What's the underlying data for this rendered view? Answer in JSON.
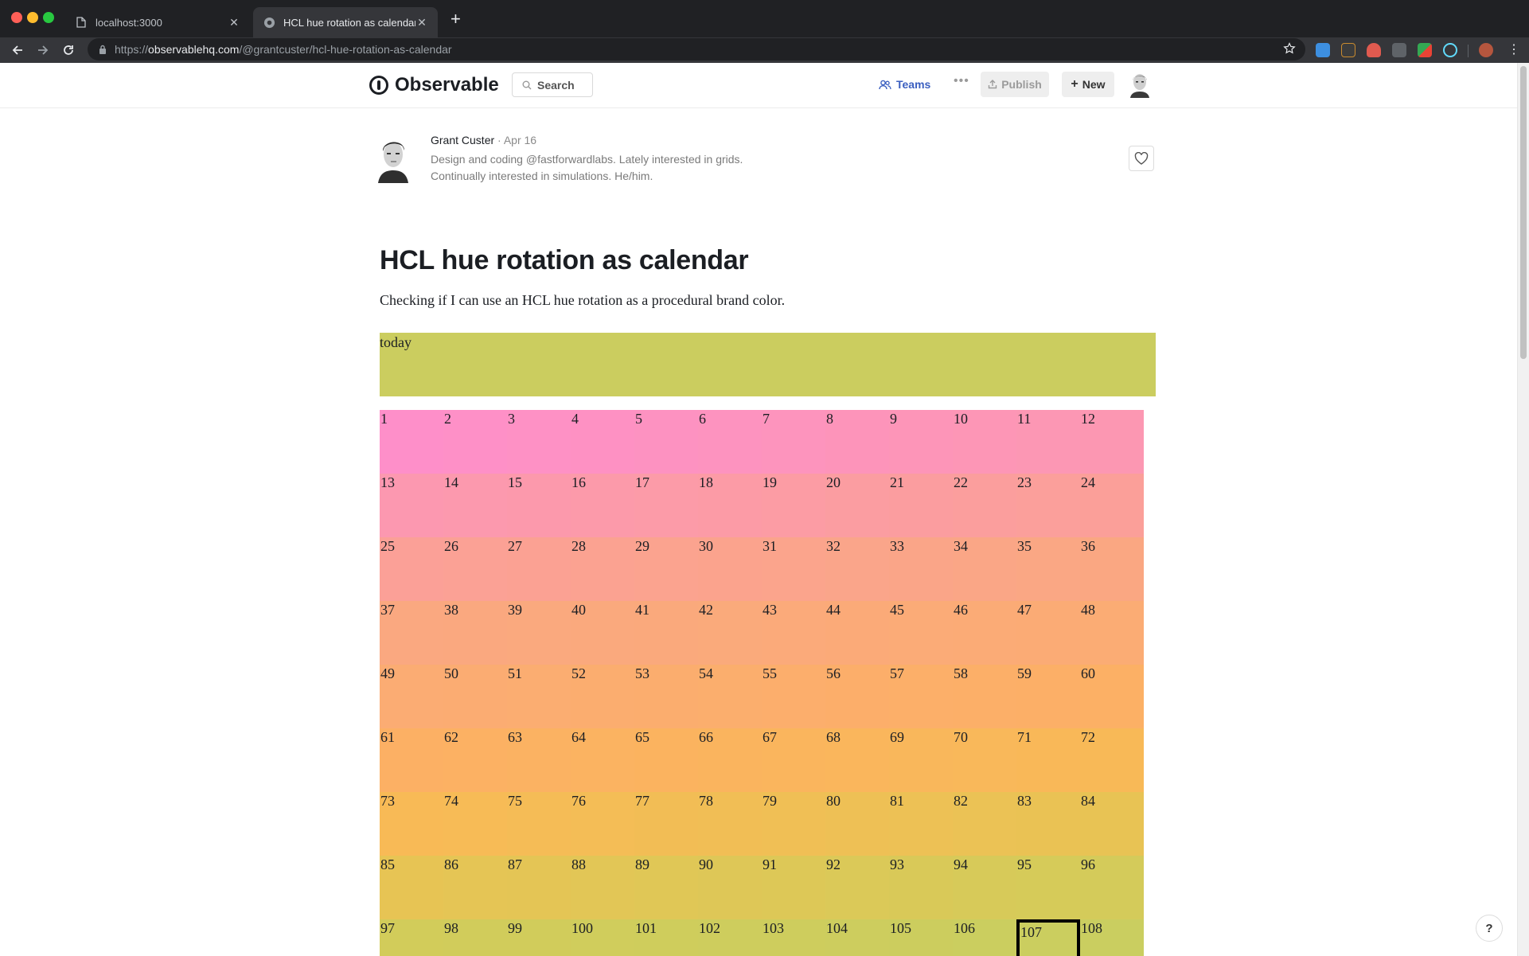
{
  "browser": {
    "tabs": [
      {
        "title": "localhost:3000",
        "icon": "document-icon",
        "active": false
      },
      {
        "title": "HCL hue rotation as calendar /",
        "icon": "observable-icon",
        "active": true
      }
    ],
    "new_tab_label": "+",
    "url_prefix": "https://",
    "url_host": "observablehq.com",
    "url_path": "/@grantcuster/hcl-hue-rotation-as-calendar"
  },
  "header": {
    "brand": "Observable",
    "search_placeholder": "Search",
    "teams_label": "Teams",
    "more_label": "•••",
    "publish_label": "Publish",
    "new_label": "New"
  },
  "author": {
    "name": "Grant Custer",
    "separator": "·",
    "date": "Apr 16",
    "bio_line1": "Design and coding @fastforwardlabs. Lately interested in grids.",
    "bio_line2": "Continually interested in simulations. He/him."
  },
  "notebook": {
    "title": "HCL hue rotation as calendar",
    "description": "Checking if I can use an HCL hue rotation as a procedural brand color.",
    "today_label": "today",
    "today_color": "#cbcd5f",
    "days_per_row": 12,
    "visible_days": 108,
    "today_day": 107
  },
  "help_label": "?"
}
